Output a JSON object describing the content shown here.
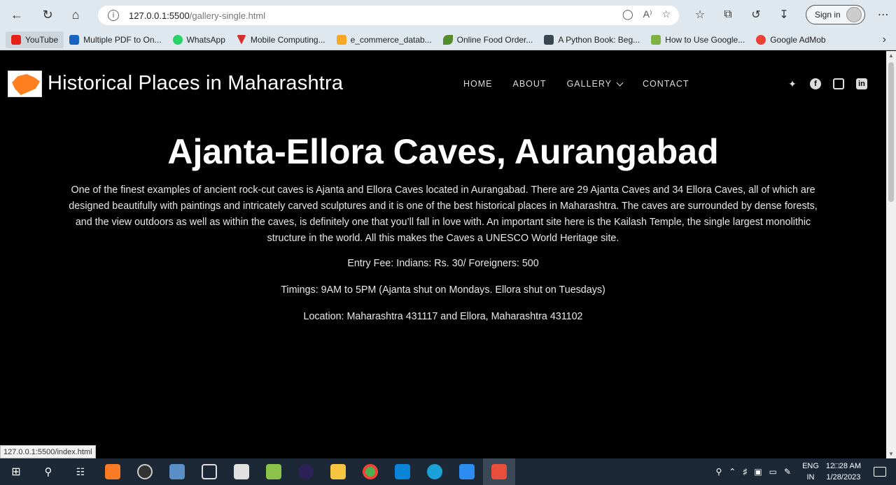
{
  "browser": {
    "url_host": "127.0.0.1:5500",
    "url_path": "/gallery-single.html",
    "signin_label": "Sign in",
    "bookmarks": [
      {
        "label": "YouTube",
        "color": "#e62117"
      },
      {
        "label": "Multiple PDF to On...",
        "color": "#1565c0"
      },
      {
        "label": "WhatsApp",
        "color": "#25d366"
      },
      {
        "label": "Mobile Computing...",
        "color": "#d32f2f"
      },
      {
        "label": "e_commerce_datab...",
        "color": "#f9a825"
      },
      {
        "label": "Online Food Order...",
        "color": "#558b2f"
      },
      {
        "label": "A Python Book: Beg...",
        "color": "#37474f"
      },
      {
        "label": "How to Use Google...",
        "color": "#7cb342"
      },
      {
        "label": "Google AdMob",
        "color": "#ea4335"
      }
    ]
  },
  "site": {
    "title": "Historical Places in Maharashtra",
    "nav": [
      "HOME",
      "ABOUT",
      "GALLERY",
      "CONTACT"
    ],
    "social": [
      "twitter-icon",
      "facebook-icon",
      "instagram-icon",
      "linkedin-icon"
    ],
    "accent": "#ff7f1f"
  },
  "content": {
    "heading": "Ajanta-Ellora Caves, Aurangabad",
    "description": "One of the finest examples of ancient rock-cut caves is Ajanta and Ellora Caves located in Aurangabad. There are 29 Ajanta Caves and 34 Ellora Caves, all of which are designed beautifully with paintings and intricately carved sculptures and it is one of the best historical places in Maharashtra. The caves are surrounded by dense forests, and the view outdoors as well as within the caves, is definitely one that you’ll fall in love with. An important site here is the Kailash Temple, the single largest monolithic structure in the world. All this makes the Caves a UNESCO World Heritage site.",
    "entry_fee": "Entry Fee: Indians: Rs. 30/ Foreigners: 500",
    "timings": "Timings: 9AM to 5PM (Ajanta shut on Mondays. Ellora shut on Tuesdays)",
    "location": "Location: Maharashtra 431117 and Ellora, Maharashtra 431102"
  },
  "status_bar": "127.0.0.1:5500/index.html",
  "taskbar": {
    "lang_top": "ENG",
    "lang_bottom": "IN",
    "time": "12□28 AM",
    "date": "1/28/2023"
  }
}
